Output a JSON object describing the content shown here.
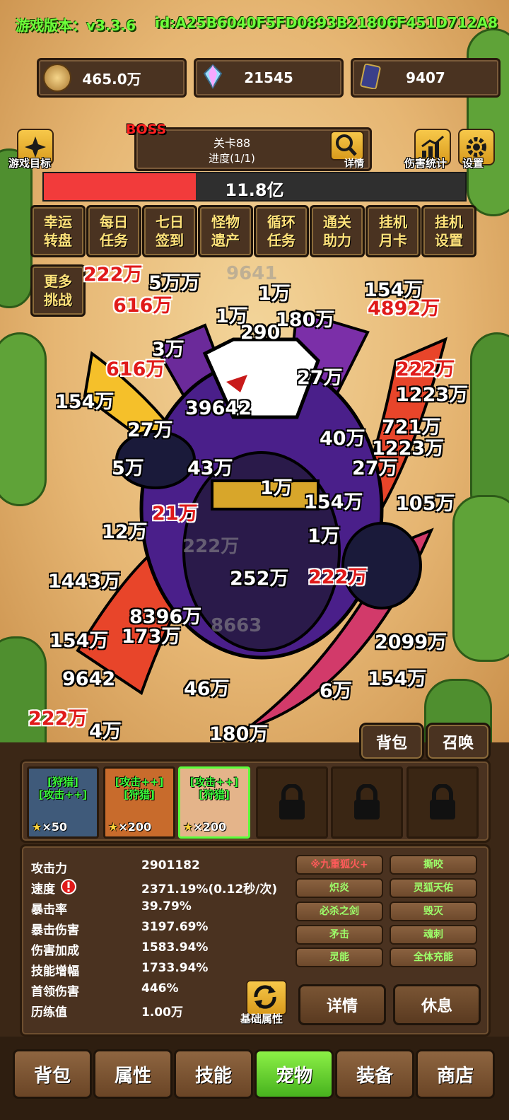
{
  "header": {
    "version": "游戏版本：v3.3.6",
    "id": "id:A25B6040F5FD0893B21806F451D712A8"
  },
  "resources": [
    {
      "icon": "coin-icon",
      "value": "465.0万"
    },
    {
      "icon": "crystal-icon",
      "value": "21545"
    },
    {
      "icon": "card-icon",
      "value": "9407"
    }
  ],
  "left_icon": {
    "icon": "star-icon",
    "label": "游戏目标"
  },
  "right_icons": [
    {
      "icon": "bar-chart-icon",
      "label": "伤害统计"
    },
    {
      "icon": "gear-icon",
      "label": "设置"
    }
  ],
  "stage": {
    "boss_tag": "BOSS",
    "level": "关卡88",
    "progress": "进度(1/1)",
    "detail_label": "详情"
  },
  "hp": {
    "text": "11.8亿",
    "fraction": 0.36
  },
  "menu_buttons": [
    {
      "l1": "幸运",
      "l2": "转盘"
    },
    {
      "l1": "每日",
      "l2": "任务"
    },
    {
      "l1": "七日",
      "l2": "签到"
    },
    {
      "l1": "怪物",
      "l2": "遗产"
    },
    {
      "l1": "循环",
      "l2": "任务"
    },
    {
      "l1": "通关",
      "l2": "助力"
    },
    {
      "l1": "挂机",
      "l2": "月卡"
    },
    {
      "l1": "挂机",
      "l2": "设置"
    },
    {
      "l1": "更多",
      "l2": "挑战"
    }
  ],
  "damage_numbers": [
    {
      "t": "5万万",
      "s": "w"
    },
    {
      "t": "9641",
      "s": "g"
    },
    {
      "t": "1万",
      "s": "w"
    },
    {
      "t": "154万",
      "s": "w"
    },
    {
      "t": "4892万",
      "s": "r"
    },
    {
      "t": "222万",
      "s": "r"
    },
    {
      "t": "616万",
      "s": "r"
    },
    {
      "t": "1万",
      "s": "w"
    },
    {
      "t": "290",
      "s": "w"
    },
    {
      "t": "180万",
      "s": "w"
    },
    {
      "t": "3万",
      "s": "w"
    },
    {
      "t": "616万",
      "s": "r"
    },
    {
      "t": "154万",
      "s": "w"
    },
    {
      "t": "27万",
      "s": "w"
    },
    {
      "t": "222万",
      "s": "r"
    },
    {
      "t": "1223万",
      "s": "w"
    },
    {
      "t": "39642",
      "s": "w"
    },
    {
      "t": "27万",
      "s": "w"
    },
    {
      "t": "721万",
      "s": "w"
    },
    {
      "t": "40万",
      "s": "w"
    },
    {
      "t": "1223万",
      "s": "w"
    },
    {
      "t": "5万",
      "s": "w"
    },
    {
      "t": "43万",
      "s": "w"
    },
    {
      "t": "27万",
      "s": "w"
    },
    {
      "t": "1万",
      "s": "w"
    },
    {
      "t": "154万",
      "s": "w"
    },
    {
      "t": "105万",
      "s": "w"
    },
    {
      "t": "21万",
      "s": "r"
    },
    {
      "t": "12万",
      "s": "w"
    },
    {
      "t": "1万",
      "s": "w"
    },
    {
      "t": "222万",
      "s": "g"
    },
    {
      "t": "1443万",
      "s": "w"
    },
    {
      "t": "252万",
      "s": "w"
    },
    {
      "t": "222万",
      "s": "r"
    },
    {
      "t": "8396万",
      "s": "w"
    },
    {
      "t": "8663",
      "s": "g"
    },
    {
      "t": "154万",
      "s": "w"
    },
    {
      "t": "173万",
      "s": "w"
    },
    {
      "t": "2099万",
      "s": "w"
    },
    {
      "t": "9642",
      "s": "w"
    },
    {
      "t": "46万",
      "s": "w"
    },
    {
      "t": "6万",
      "s": "w"
    },
    {
      "t": "154万",
      "s": "w"
    },
    {
      "t": "222万",
      "s": "r"
    },
    {
      "t": "4万",
      "s": "w"
    },
    {
      "t": "180万",
      "s": "w"
    }
  ],
  "top_buttons": [
    "背包",
    "召唤"
  ],
  "pets": [
    {
      "l1": "[狩猎]",
      "l2": "[攻击++]",
      "count": "×50",
      "bg": "#3f5a7a"
    },
    {
      "l1": "[攻击++]",
      "l2": "[狩猎]",
      "count": "×200",
      "bg": "#c86b2c"
    },
    {
      "l1": "[攻击++]",
      "l2": "[狩猎]",
      "count": "×200",
      "bg": "#e4b48a"
    }
  ],
  "stats": [
    {
      "label": "攻击力",
      "value": "2901182"
    },
    {
      "label": "速度",
      "value": "2371.19%(0.12秒/次)"
    },
    {
      "label": "暴击率",
      "value": "39.79%"
    },
    {
      "label": "暴击伤害",
      "value": "3197.69%"
    },
    {
      "label": "伤害加成",
      "value": "1583.94%"
    },
    {
      "label": "技能增幅",
      "value": "1733.94%"
    },
    {
      "label": "首领伤害",
      "value": "446%"
    },
    {
      "label": "历练值",
      "value": "1.00万"
    }
  ],
  "skills": [
    {
      "name": "※九重狐火+",
      "color": "#ff5a5a"
    },
    {
      "name": "撕咬",
      "color": "#9dff6a"
    },
    {
      "name": "炽炎",
      "color": "#9dff6a"
    },
    {
      "name": "灵狐天佑",
      "color": "#9dff6a"
    },
    {
      "name": "必杀之剑",
      "color": "#9dff6a"
    },
    {
      "name": "毁灭",
      "color": "#9dff6a"
    },
    {
      "name": "矛击",
      "color": "#9dff6a"
    },
    {
      "name": "魂刺",
      "color": "#9dff6a"
    },
    {
      "name": "灵能",
      "color": "#9dff6a"
    },
    {
      "name": "全体充能",
      "color": "#9dff6a"
    }
  ],
  "base_attr_label": "基础属性",
  "detail_button": "详情",
  "rest_button": "休息",
  "tabs": [
    {
      "label": "背包",
      "active": false
    },
    {
      "label": "属性",
      "active": false
    },
    {
      "label": "技能",
      "active": false
    },
    {
      "label": "宠物",
      "active": true
    },
    {
      "label": "装备",
      "active": false
    },
    {
      "label": "商店",
      "active": false
    }
  ]
}
